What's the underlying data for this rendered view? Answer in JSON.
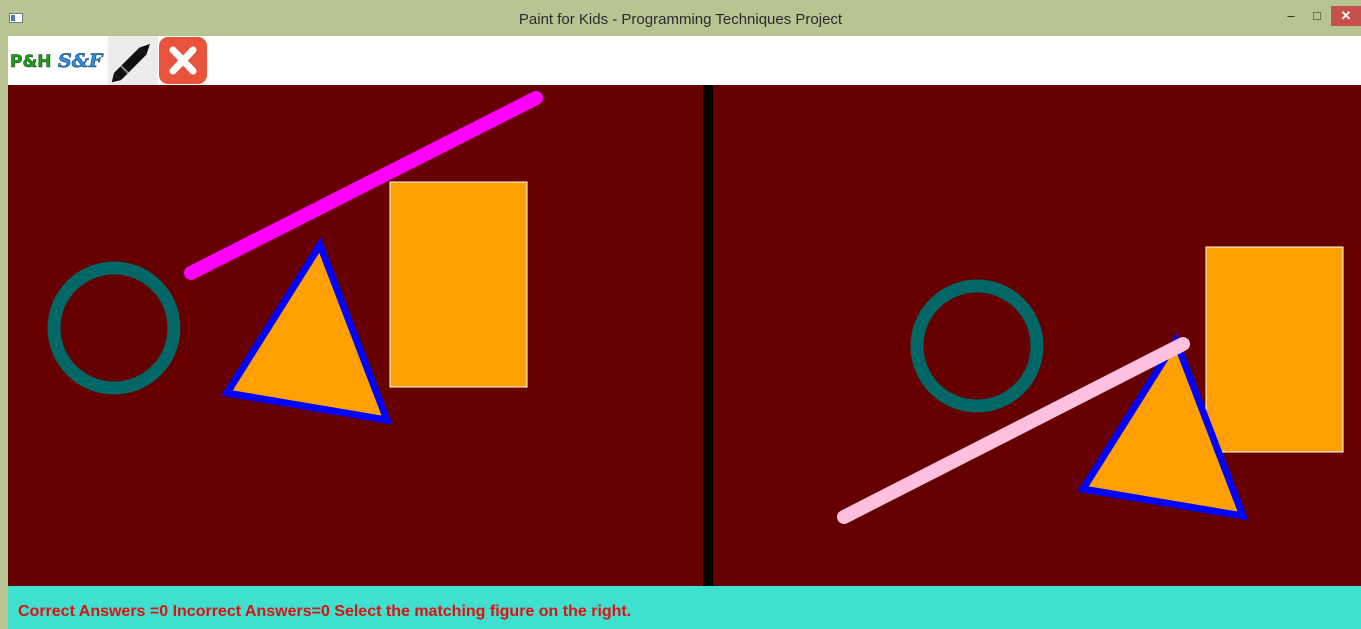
{
  "window": {
    "title": "Paint for Kids - Programming Techniques Project",
    "controls": {
      "minimize": "‒",
      "maximize": "□",
      "close": "✕"
    }
  },
  "toolbar": {
    "items": [
      {
        "name": "logo",
        "icon": "ph-sf-logo-icon"
      },
      {
        "name": "draw-mode",
        "icon": "pen-icon"
      },
      {
        "name": "exit",
        "icon": "close-icon"
      }
    ],
    "logo_text": {
      "part1": "P&H",
      "part2": "S&F"
    }
  },
  "canvas": {
    "background": "#660000",
    "divider_color": "#000000",
    "left_figures": [
      {
        "type": "line",
        "color": "#ff00ff"
      },
      {
        "type": "rectangle",
        "fill": "#ffa000"
      },
      {
        "type": "circle",
        "border": "#006666"
      },
      {
        "type": "triangle",
        "fill": "#ffa000",
        "border": "#0000ff"
      }
    ],
    "right_figures": [
      {
        "type": "circle",
        "border": "#006666"
      },
      {
        "type": "rectangle",
        "fill": "#ffa000"
      },
      {
        "type": "triangle",
        "fill": "#ffa000",
        "border": "#0000ff"
      },
      {
        "type": "line",
        "color": "#ffc0e0"
      }
    ]
  },
  "status": {
    "text": "Correct Answers =0 Incorrect Answers=0 Select the matching figure on the right.",
    "background": "#40e0d0",
    "color": "#e01010"
  }
}
